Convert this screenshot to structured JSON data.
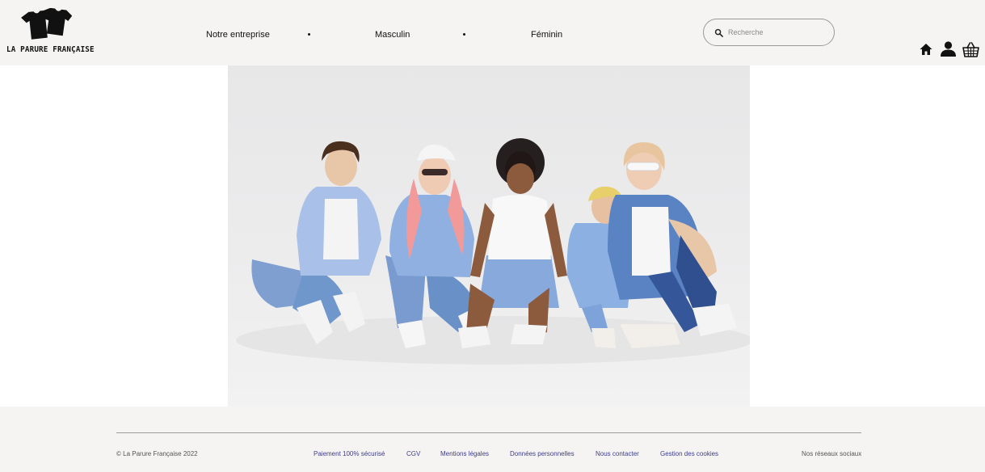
{
  "header": {
    "logo_text": "LA PARURE FRANÇAISE",
    "nav": [
      {
        "label": "Notre entreprise"
      },
      {
        "label": "Masculin"
      },
      {
        "label": "Féminin"
      }
    ],
    "search": {
      "placeholder": "Recherche",
      "icon": "search-icon"
    },
    "icons": [
      "home-icon",
      "user-icon",
      "basket-icon"
    ]
  },
  "hero": {
    "image": "photo-group-of-five-young-people-in-denim-sitting-on-floor"
  },
  "footer": {
    "copyright": "© La Parure Française 2022",
    "links": [
      {
        "label": "Paiement 100% sécurisé"
      },
      {
        "label": "CGV"
      },
      {
        "label": "Mentions légales"
      },
      {
        "label": "Données personnelles"
      },
      {
        "label": "Nous contacter"
      },
      {
        "label": "Gestion des cookies"
      }
    ],
    "social": "Nos réseaux sociaux"
  },
  "colors": {
    "header_bg": "#f5f4f2",
    "footer_link": "#3d3d8a",
    "text": "#111111"
  }
}
